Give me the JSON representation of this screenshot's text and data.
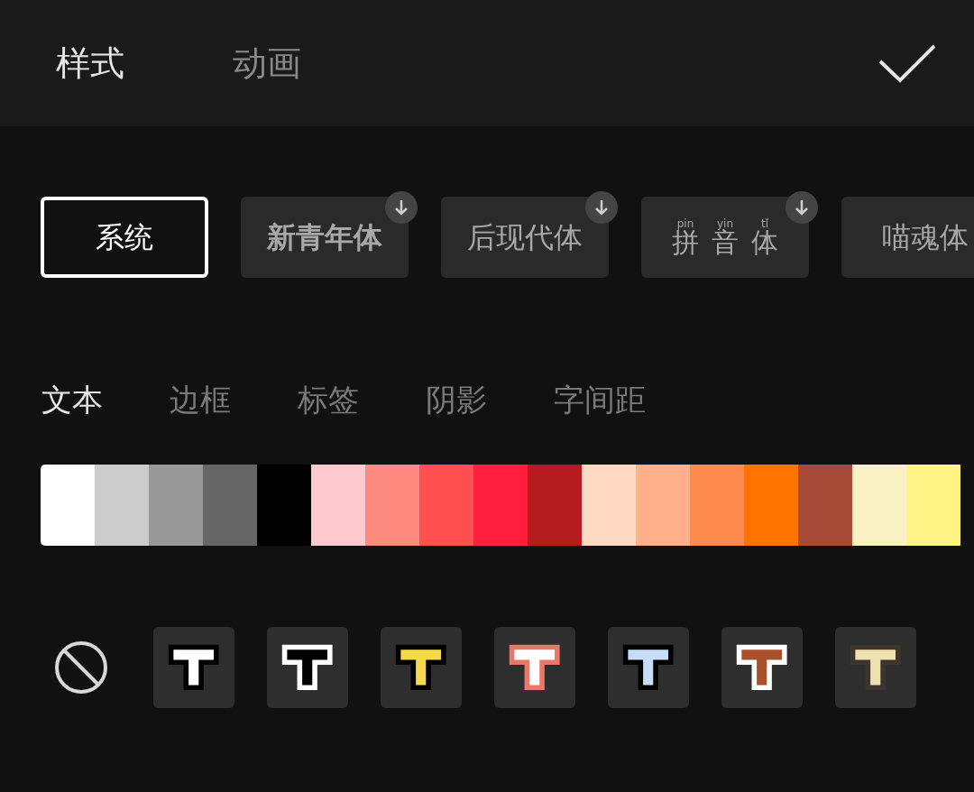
{
  "tabs": [
    {
      "label": "样式",
      "selected": true
    },
    {
      "label": "动画",
      "selected": false
    }
  ],
  "fonts": [
    {
      "label": "系统",
      "kind": "regular",
      "selected": true,
      "download": false
    },
    {
      "label": "新青年体",
      "kind": "bold",
      "selected": false,
      "download": true
    },
    {
      "label": "后现代体",
      "kind": "regular",
      "selected": false,
      "download": true
    },
    {
      "kind": "pinyin",
      "chars": [
        {
          "char": "拼",
          "pinyin": "pin"
        },
        {
          "char": "音",
          "pinyin": "yin"
        },
        {
          "char": "体",
          "pinyin": "tǐ"
        }
      ],
      "selected": false,
      "download": true
    },
    {
      "label": "喵魂体",
      "kind": "regular",
      "selected": false
    }
  ],
  "sub_tabs": [
    {
      "label": "文本",
      "selected": true
    },
    {
      "label": "边框",
      "selected": false
    },
    {
      "label": "标签",
      "selected": false
    },
    {
      "label": "阴影",
      "selected": false
    },
    {
      "label": "字间距",
      "selected": false
    }
  ],
  "swatches": [
    {
      "color": "#ffffff"
    },
    {
      "color": "#cccccc"
    },
    {
      "color": "#999999"
    },
    {
      "color": "#666666"
    },
    {
      "color": "#000000"
    },
    {
      "color": "#ffc9d0"
    },
    {
      "color": "#ff8a80"
    },
    {
      "color": "#ff4f4f"
    },
    {
      "color": "#ff1f3d"
    },
    {
      "color": "#b51c1f"
    },
    {
      "color": "#ffd9c4"
    },
    {
      "color": "#ffb08a"
    },
    {
      "color": "#ff8a4d"
    },
    {
      "color": "#ff7300"
    },
    {
      "color": "#a84a38"
    },
    {
      "color": "#f9f0c4"
    },
    {
      "color": "#fff383"
    }
  ],
  "presets": [
    {
      "fill": {
        "color": "#ffffff"
      },
      "outline": {
        "color": "#000000"
      }
    },
    {
      "fill": {
        "color": "#000000"
      },
      "outline": {
        "color": "#ffffff"
      }
    },
    {
      "fill": {
        "color": "#f5d94a"
      },
      "outline": {
        "color": "#000000"
      }
    },
    {
      "fill": {
        "color": "#ffffff"
      },
      "outline": {
        "color": "#e8786a"
      }
    },
    {
      "fill": {
        "color": "#c6dcf7"
      },
      "outline": {
        "color": "#000000"
      }
    },
    {
      "fill": {
        "color": "#a8502a"
      },
      "outline": {
        "color": "#ffffff"
      }
    },
    {
      "fill": {
        "color": "#efe0b0"
      },
      "outline": {
        "color": "#3d352c"
      }
    }
  ]
}
